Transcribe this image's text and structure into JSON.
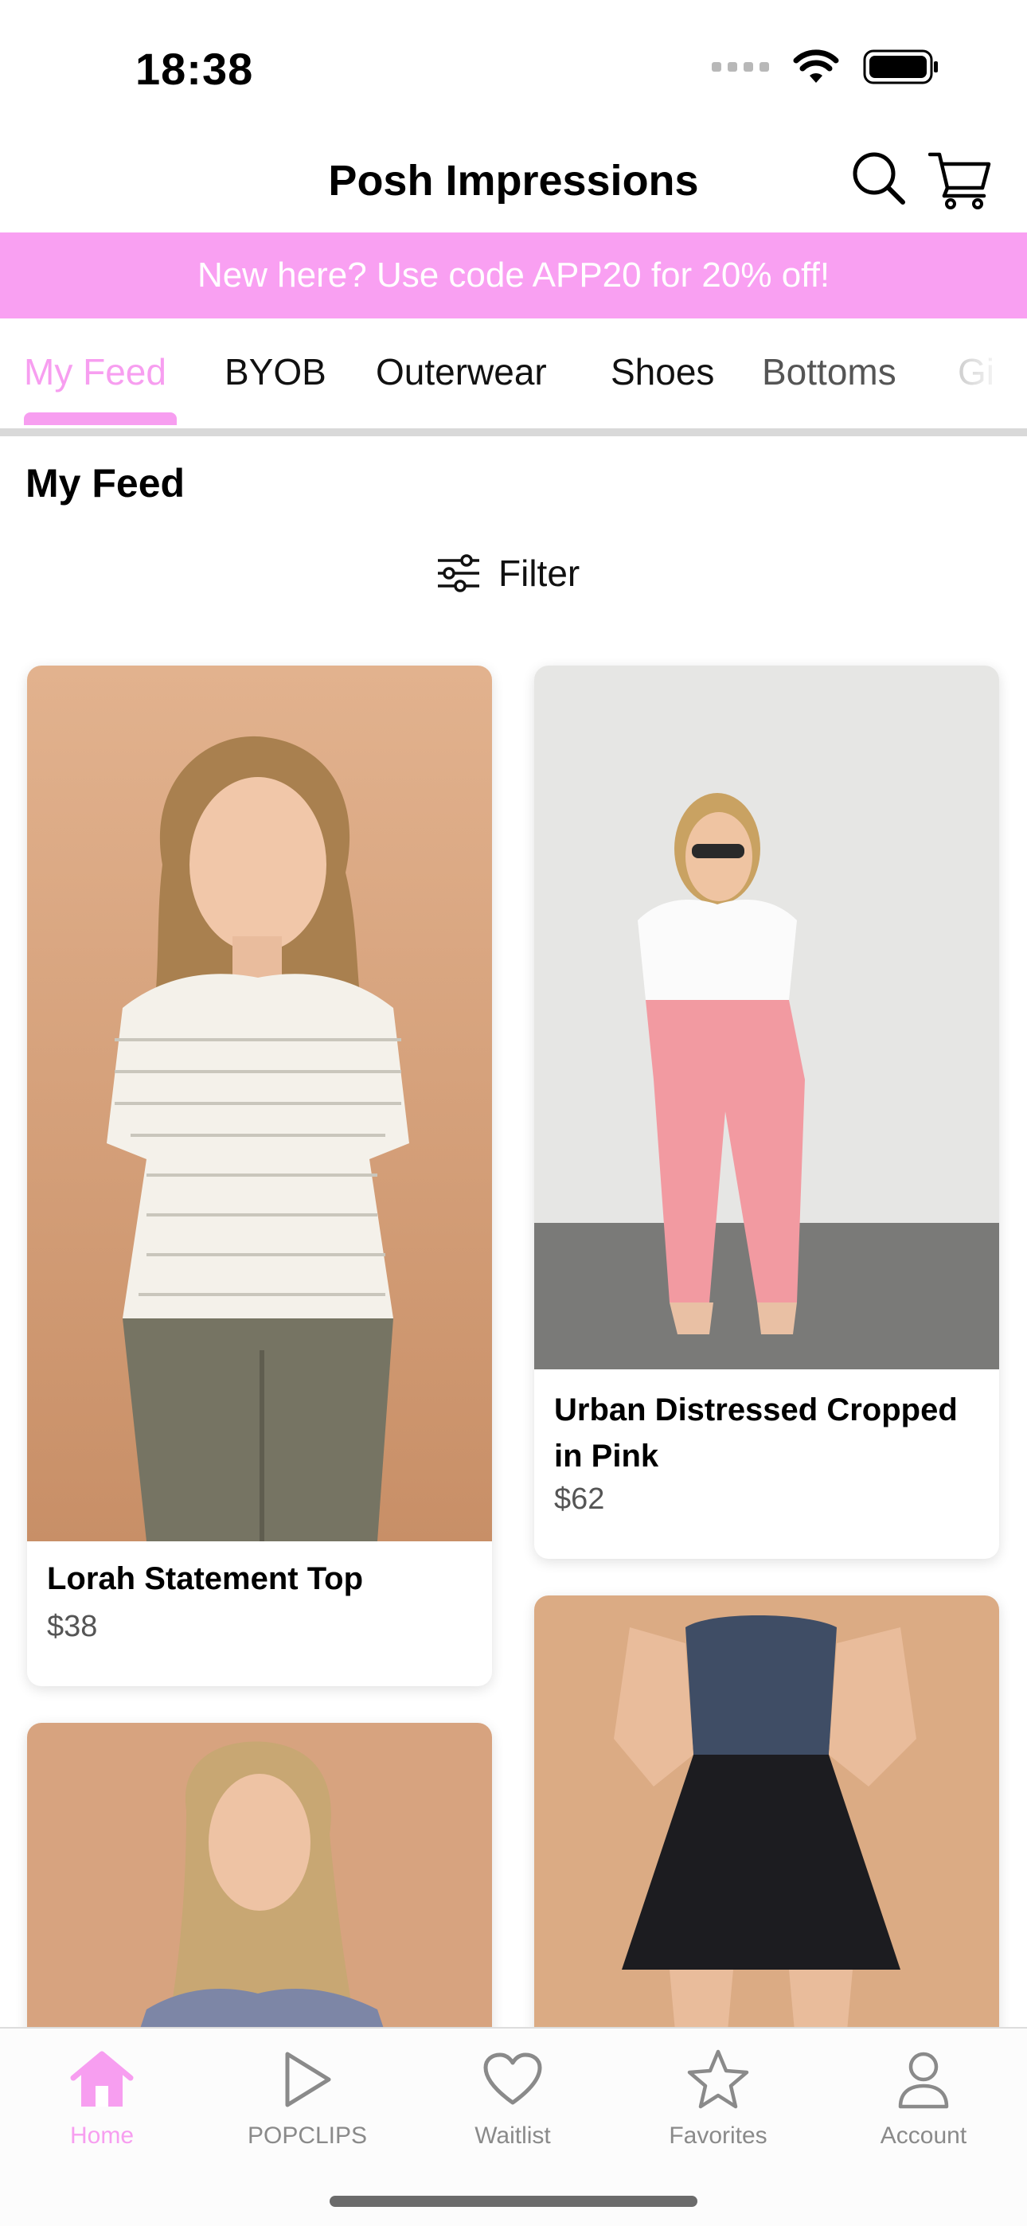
{
  "status_bar": {
    "time": "18:38",
    "icons": [
      "signal-icon",
      "wifi-icon",
      "battery-icon"
    ]
  },
  "header": {
    "title": "Posh Impressions",
    "icons": [
      "search-icon",
      "cart-icon"
    ]
  },
  "promo": {
    "text": "New here? Use code APP20 for 20% off!",
    "background": "#f9a0f2"
  },
  "category_tabs": [
    {
      "label": "My Feed",
      "active": true
    },
    {
      "label": "BYOB",
      "active": false
    },
    {
      "label": "Outerwear",
      "active": false
    },
    {
      "label": "Shoes",
      "active": false
    },
    {
      "label": "Bottoms",
      "active": false
    },
    {
      "label": "Gi",
      "active": false
    }
  ],
  "feed": {
    "title": "My Feed",
    "filter_label": "Filter",
    "filter_icon": "sliders-icon"
  },
  "products": [
    {
      "name": "Lorah Statement Top",
      "price": "$38"
    },
    {
      "name": "Urban Distressed Cropped in Pink",
      "price": "$62"
    },
    {
      "name": "",
      "price": ""
    },
    {
      "name": "",
      "price": ""
    }
  ],
  "tab_bar": [
    {
      "label": "Home",
      "icon": "home-icon",
      "active": true
    },
    {
      "label": "POPCLIPS",
      "icon": "play-icon",
      "active": false
    },
    {
      "label": "Waitlist",
      "icon": "heart-icon",
      "active": false
    },
    {
      "label": "Favorites",
      "icon": "star-icon",
      "active": false
    },
    {
      "label": "Account",
      "icon": "person-icon",
      "active": false
    }
  ],
  "colors": {
    "accent": "#f79ef0",
    "banner": "#f9a0f2",
    "inactive": "#8a8a8a"
  }
}
